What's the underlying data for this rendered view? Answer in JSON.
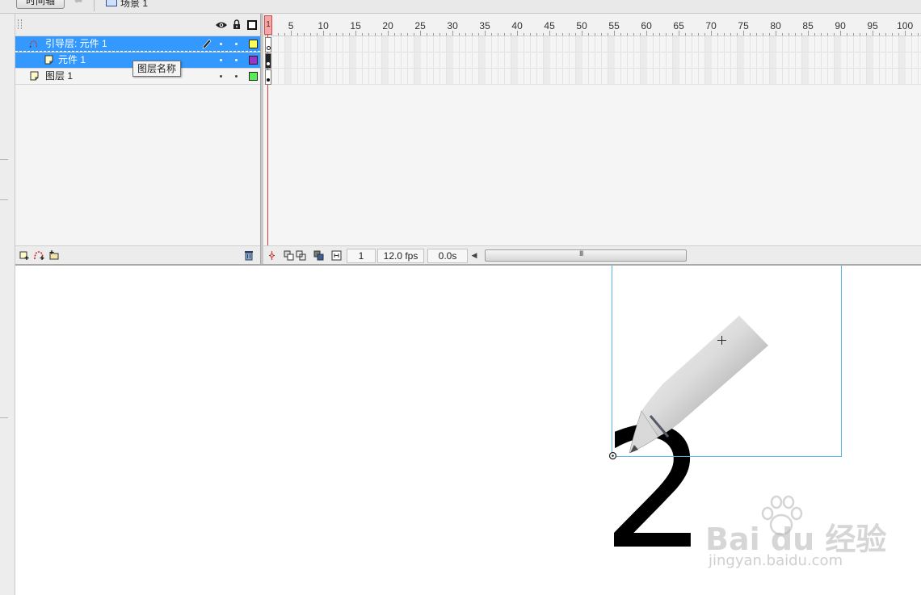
{
  "topbar": {
    "timeline_tab_label": "时间轴",
    "scene_label": "场景 1",
    "back_icon": "back-arrow-icon",
    "scene_icon": "scene-clapper-icon"
  },
  "layers": {
    "header_icons": [
      "eye-icon",
      "lock-icon",
      "outline-icon"
    ],
    "rows": [
      {
        "name": "引导层: 元件 1",
        "type": "motion-guide",
        "selected": true,
        "color": "#ffff55"
      },
      {
        "name": "元件 1",
        "type": "guided-layer",
        "selected": true,
        "color": "#9933cc"
      },
      {
        "name": "图层 1",
        "type": "normal",
        "selected": false,
        "color": "#55ee55"
      }
    ],
    "tooltip": "图层名称",
    "footer_icons": [
      "insert-layer-icon",
      "add-motion-guide-icon",
      "insert-folder-icon",
      "trash-icon"
    ]
  },
  "timeline": {
    "ruler_labels": [
      "1",
      "5",
      "10",
      "15",
      "20",
      "25",
      "30",
      "35",
      "40",
      "45",
      "50",
      "55",
      "60",
      "65",
      "70",
      "75",
      "80",
      "85",
      "90",
      "95",
      "100"
    ],
    "current_frame": "1",
    "frame_rate": "12.0 fps",
    "elapsed_time": "0.0s",
    "scrollbar_grip": "III",
    "footer_icons": [
      "center-frame-icon",
      "onion-skin-icon",
      "onion-skin-outlines-icon",
      "edit-multiple-frames-icon",
      "modify-onion-markers-icon"
    ]
  },
  "stage": {
    "drawn_text": "2",
    "pen_colors": {
      "grip": "#7cc22d",
      "barrel_light": "#f2f2f2",
      "barrel_dark": "#9a9a9a",
      "ring": "#555a6a"
    },
    "bounding_box_color": "#5ab7e5"
  },
  "watermark": {
    "brand": "Bai du 经验",
    "url": "jingyan.baidu.com"
  }
}
